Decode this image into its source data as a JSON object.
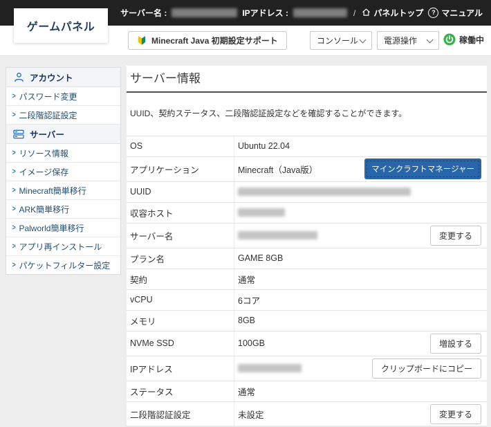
{
  "topbar": {
    "server_name_label": "サーバー名 :",
    "ip_label": "IPアドレス :",
    "separator": "/",
    "panel_top": "パネルトップ",
    "manual": "マニュアル",
    "server_name_redacted": true,
    "ip_redacted": true
  },
  "logo": "ゲームパネル",
  "toolbar": {
    "minecraft_support": "Minecraft Java 初期設定サポート",
    "console_select": "コンソール",
    "power_select": "電源操作",
    "status": "稼働中"
  },
  "sidebar": {
    "sections": [
      {
        "title": "アカウント",
        "icon": "user-icon",
        "items": [
          "パスワード変更",
          "二段階認証設定"
        ]
      },
      {
        "title": "サーバー",
        "icon": "server-icon",
        "items": [
          "リソース情報",
          "イメージ保存",
          "Minecraft簡単移行",
          "ARK簡単移行",
          "Palworld簡単移行",
          "アプリ再インストール",
          "パケットフィルター設定"
        ]
      }
    ]
  },
  "main": {
    "title": "サーバー情報",
    "description": "UUID、契約ステータス、二段階認証設定などを確認することができます。",
    "rows": [
      {
        "label": "OS",
        "value": "Ubuntu 22.04"
      },
      {
        "label": "アプリケーション",
        "value": "Minecraft（Java版）",
        "button": "マインクラフトマネージャー",
        "button_style": "primary",
        "button_name": "minecraft-manager-button"
      },
      {
        "label": "UUID",
        "redacted": true,
        "redact_width": 250
      },
      {
        "label": "収容ホスト",
        "redacted": true,
        "redact_width": 68
      },
      {
        "label": "サーバー名",
        "redacted": true,
        "redact_width": 115,
        "button": "変更する",
        "button_style": "secondary",
        "button_name": "change-server-name-button"
      },
      {
        "label": "プラン名",
        "value": "GAME 8GB"
      },
      {
        "label": "契約",
        "value": "通常"
      },
      {
        "label": "vCPU",
        "value": "6コア"
      },
      {
        "label": "メモリ",
        "value": "8GB"
      },
      {
        "label": "NVMe SSD",
        "value": "100GB",
        "button": "増設する",
        "button_style": "secondary",
        "button_name": "expand-ssd-button"
      },
      {
        "label": "IPアドレス",
        "redacted": true,
        "redact_width": 92,
        "button": "クリップボードにコピー",
        "button_style": "secondary",
        "button_name": "copy-ip-button"
      },
      {
        "label": "ステータス",
        "value": "通常"
      },
      {
        "label": "二段階認証設定",
        "value": "未設定",
        "button": "変更する",
        "button_style": "secondary",
        "button_name": "change-2fa-button"
      }
    ]
  },
  "colors": {
    "topbar_bg": "#212121",
    "accent_blue": "#2d73b5",
    "primary_button": "#2766ab",
    "running_green": "#35b24b",
    "beginner_mark_yellow": "#eec200",
    "beginner_mark_green": "#00916e"
  }
}
